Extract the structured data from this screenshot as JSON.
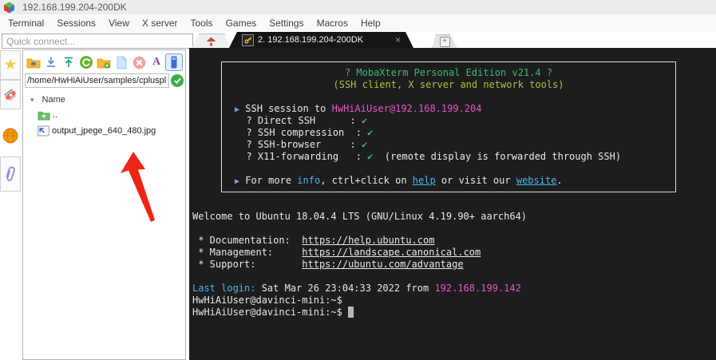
{
  "window": {
    "title": "192.168.199.204-200DK"
  },
  "menu": {
    "items": [
      "Terminal",
      "Sessions",
      "View",
      "X server",
      "Tools",
      "Games",
      "Settings",
      "Macros",
      "Help"
    ]
  },
  "quick_connect": {
    "placeholder": "Quick connect..."
  },
  "tabs": {
    "active": {
      "label": "2. 192.168.199.204-200DK",
      "close": "×"
    },
    "new_tab": "+"
  },
  "sidebar": {
    "icons": [
      "star-icon",
      "swiss-knife-icon",
      "globe-icon",
      "paperclip-icon"
    ]
  },
  "file_browser": {
    "toolbar_icons": [
      "parent-folder-icon",
      "download-icon",
      "upload-icon",
      "refresh-icon",
      "new-folder-icon",
      "new-file-icon",
      "delete-icon",
      "rename-icon",
      "follow-terminal-folder-icon"
    ],
    "path": "/home/HwHiAiUser/samples/cplusplu",
    "column_header": "Name",
    "sort_indicator": "▾",
    "rows": [
      {
        "icon": "folder-up-icon",
        "name": ".."
      },
      {
        "icon": "image-file-icon",
        "name": "output_jpege_640_480.jpg"
      }
    ]
  },
  "annotation": {
    "type": "red-arrow",
    "color": "#ee2516"
  },
  "terminal": {
    "colors": {
      "background": "#1d1d1d",
      "foreground": "#e8e8e8",
      "green": "#3cb878",
      "yellow": "#b8bd3c",
      "cyan": "#4ab6e8",
      "magenta": "#e557c6",
      "arrow_blue": "#7d9ce0"
    },
    "banner_lines": [
      {
        "center": true,
        "s": [
          {
            "t": "? MobaXterm Personal Edition v21.4 ?",
            "c": "green"
          }
        ]
      },
      {
        "center": true,
        "s": [
          {
            "t": "(SSH client, X server and network tools)",
            "c": "yellow"
          }
        ]
      },
      {
        "s": []
      },
      {
        "s": [
          {
            "t": "▶",
            "c": "arrow"
          },
          {
            "t": " SSH session to ",
            "c": "white"
          },
          {
            "t": "HwHiAiUser@192.168.199.204",
            "c": "magenta"
          }
        ]
      },
      {
        "s": [
          {
            "t": "  ? Direct SSH      : ",
            "c": "white"
          },
          {
            "t": "✔",
            "c": "green"
          }
        ]
      },
      {
        "s": [
          {
            "t": "  ? SSH compression  : ",
            "c": "white"
          },
          {
            "t": "✔",
            "c": "green"
          }
        ]
      },
      {
        "s": [
          {
            "t": "  ? SSH-browser     : ",
            "c": "white"
          },
          {
            "t": "✔",
            "c": "green"
          }
        ]
      },
      {
        "s": [
          {
            "t": "  ? X11-forwarding   : ",
            "c": "white"
          },
          {
            "t": "✔",
            "c": "green"
          },
          {
            "t": "  (remote display is forwarded through SSH)",
            "c": "white"
          }
        ]
      },
      {
        "s": []
      },
      {
        "s": [
          {
            "t": "▶",
            "c": "arrow"
          },
          {
            "t": " For more ",
            "c": "white"
          },
          {
            "t": "info",
            "c": "cyan"
          },
          {
            "t": ", ctrl+click on ",
            "c": "white"
          },
          {
            "t": "help",
            "c": "cyanu"
          },
          {
            "t": " or visit our ",
            "c": "white"
          },
          {
            "t": "website",
            "c": "cyanu"
          },
          {
            "t": ".",
            "c": "white"
          }
        ]
      }
    ],
    "body_lines": [
      {
        "s": []
      },
      {
        "s": [
          {
            "t": "Welcome to Ubuntu 18.04.4 LTS (GNU/Linux 4.19.90+ aarch64)",
            "c": "white"
          }
        ]
      },
      {
        "s": []
      },
      {
        "s": [
          {
            "t": " * Documentation:  ",
            "c": "white"
          },
          {
            "t": "https://help.ubuntu.com",
            "c": "whiteu"
          }
        ]
      },
      {
        "s": [
          {
            "t": " * Management:     ",
            "c": "white"
          },
          {
            "t": "https://landscape.canonical.com",
            "c": "whiteu"
          }
        ]
      },
      {
        "s": [
          {
            "t": " * Support:        ",
            "c": "white"
          },
          {
            "t": "https://ubuntu.com/advantage",
            "c": "whiteu"
          }
        ]
      },
      {
        "s": []
      },
      {
        "s": [
          {
            "t": "Last login:",
            "c": "cyan"
          },
          {
            "t": " Sat Mar 26 23:04:33 2022 from ",
            "c": "white"
          },
          {
            "t": "192.168.199.142",
            "c": "magenta"
          }
        ]
      },
      {
        "s": [
          {
            "t": "HwHiAiUser@davinci-mini:~$",
            "c": "white"
          }
        ]
      },
      {
        "s": [
          {
            "t": "HwHiAiUser@davinci-mini:~$ ",
            "c": "white"
          },
          {
            "t": " ",
            "c": "cursor"
          }
        ]
      }
    ]
  }
}
